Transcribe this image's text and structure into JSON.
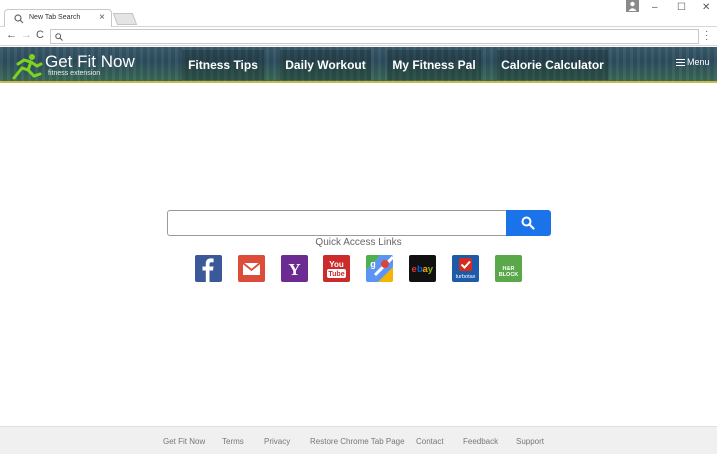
{
  "browser": {
    "tab_title": "New Tab Search",
    "tab_close": "×",
    "window_controls": [
      "–",
      "☐",
      "✕"
    ],
    "nav": [
      "←",
      "→",
      "C"
    ]
  },
  "banner": {
    "logo_title": "Get Fit Now",
    "logo_subtitle": "fitness extension",
    "nav_items": [
      "Fitness Tips",
      "Daily Workout",
      "My Fitness Pal",
      "Calorie Calculator"
    ],
    "menu_label": "Menu"
  },
  "search": {
    "placeholder": "",
    "quick_access_title": "Quick Access Links"
  },
  "quick_links": [
    {
      "name": "facebook",
      "label": "f",
      "color": "#3b5998"
    },
    {
      "name": "gmail",
      "label": "",
      "color": "#dd4b39"
    },
    {
      "name": "yahoo",
      "label": "Y",
      "color": "#6c2b93"
    },
    {
      "name": "youtube",
      "label": "You Tube",
      "color": "#cc2b2b"
    },
    {
      "name": "google-maps",
      "label": "g",
      "color": "#4caf50"
    },
    {
      "name": "ebay",
      "label": "ebay",
      "color": "#111111"
    },
    {
      "name": "turbotax",
      "label": "turbotax",
      "color": "#1d5aa8"
    },
    {
      "name": "hr-block",
      "label": "H&R BLOCK",
      "color": "#5aa84a"
    }
  ],
  "footer": {
    "links": [
      "Get Fit Now",
      "Terms",
      "Privacy",
      "Restore Chrome Tab Page",
      "Contact",
      "Feedback",
      "Support"
    ]
  },
  "colors": {
    "accent": "#1a73e8",
    "banner_border": "#c9b94a"
  }
}
